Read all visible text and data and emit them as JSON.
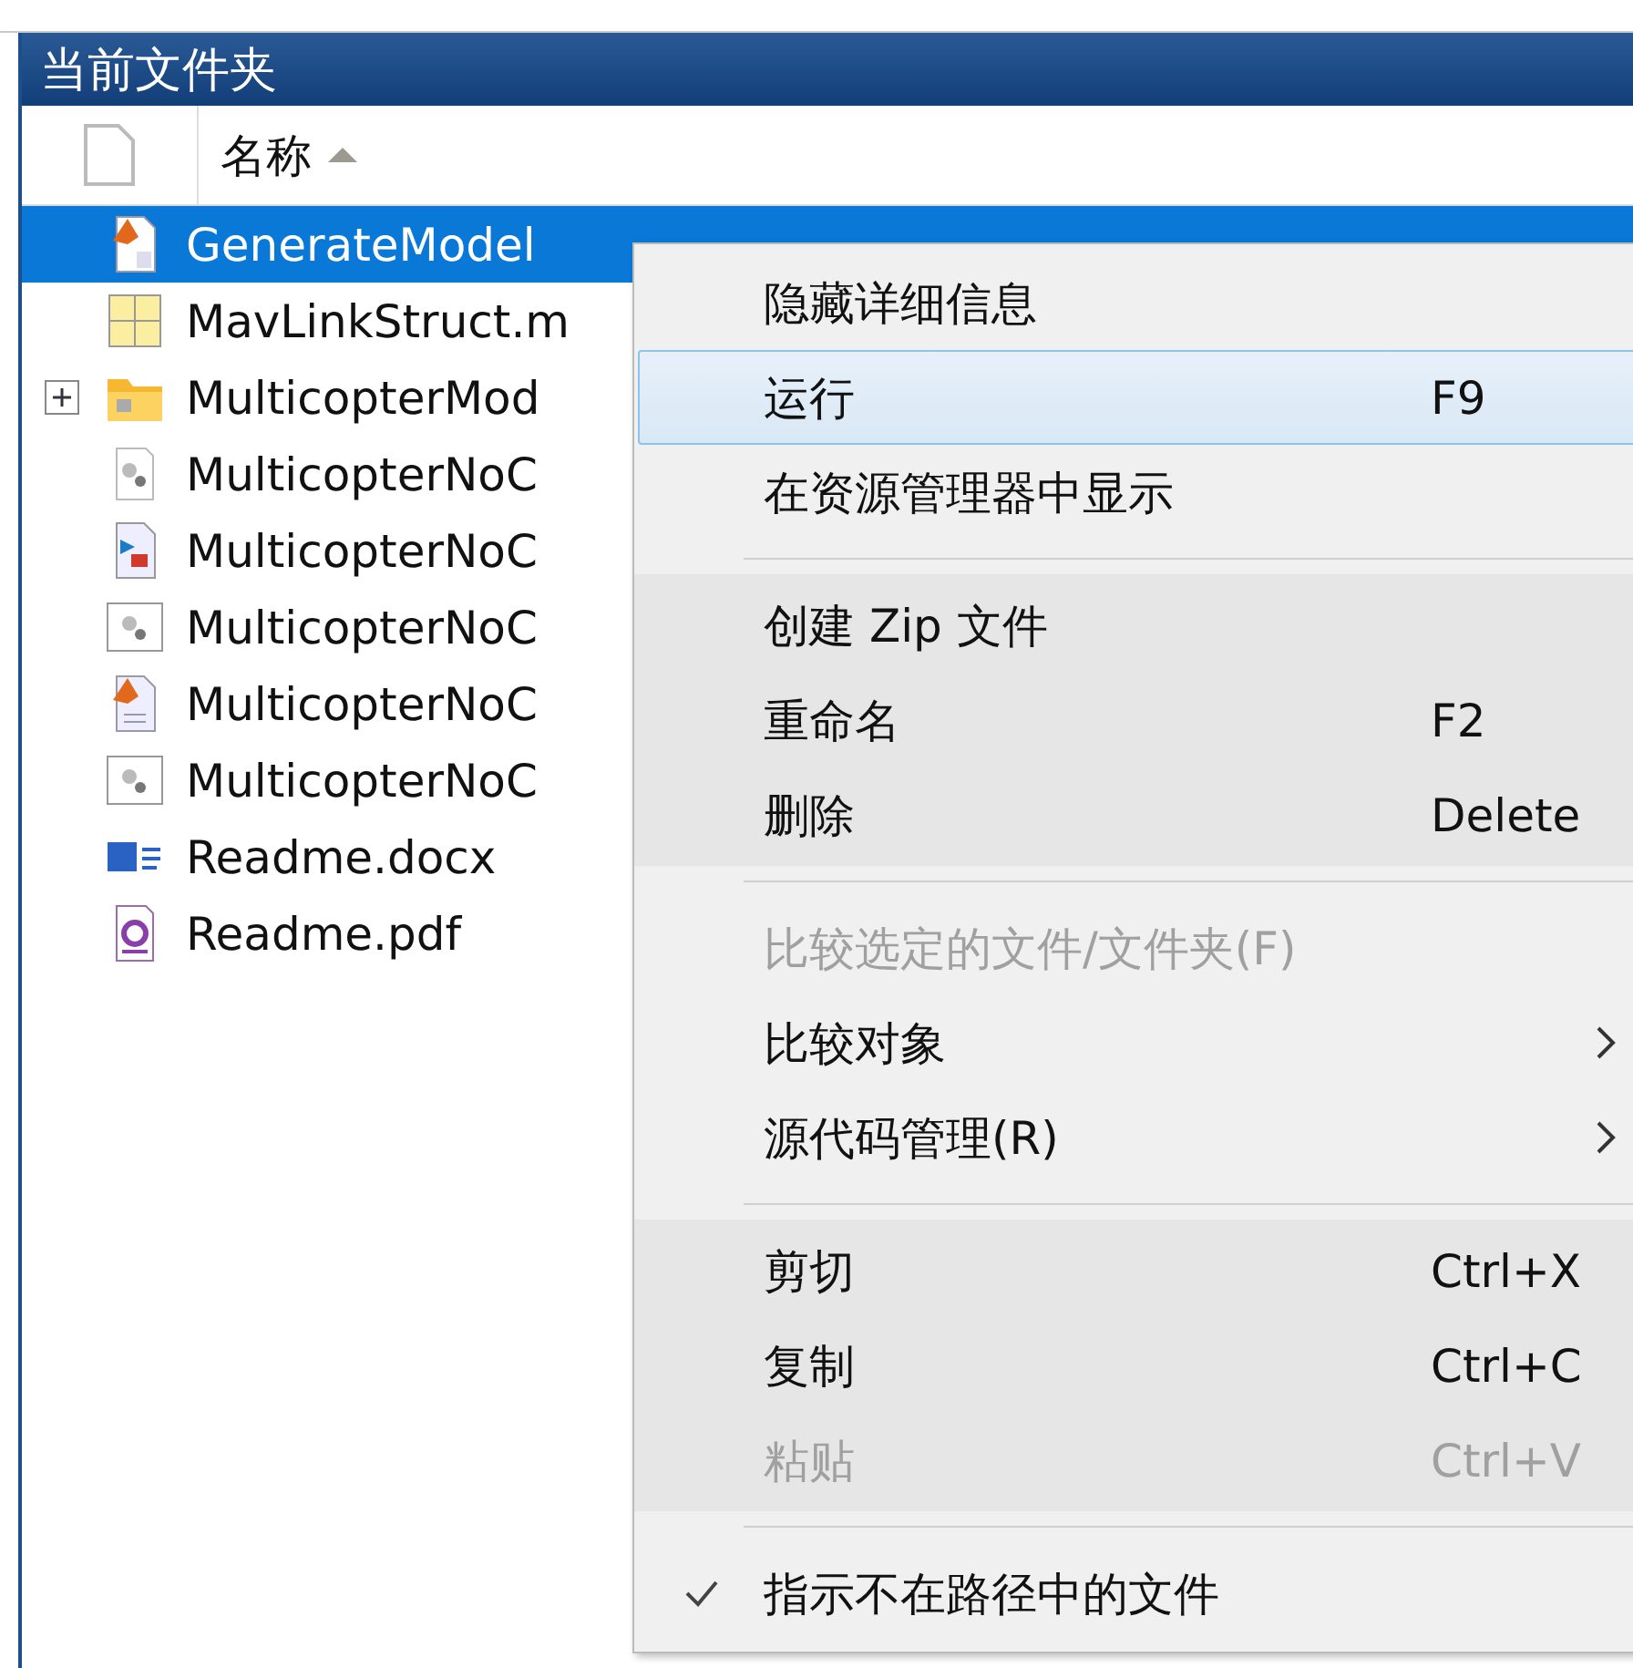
{
  "panel": {
    "title": "当前文件夹"
  },
  "table": {
    "columns": [
      {
        "label": "名称",
        "sorted": true
      }
    ],
    "rows": [
      {
        "name": "GenerateModel",
        "kind": "p-file",
        "selected": true,
        "expandable": false
      },
      {
        "name": "MavLinkStruct.m",
        "kind": "struct",
        "selected": false,
        "expandable": false
      },
      {
        "name": "MulticopterMod",
        "kind": "folder",
        "selected": false,
        "expandable": true
      },
      {
        "name": "MulticopterNoC",
        "kind": "gear-file",
        "selected": false,
        "expandable": false
      },
      {
        "name": "MulticopterNoC",
        "kind": "model",
        "selected": false,
        "expandable": false
      },
      {
        "name": "MulticopterNoC",
        "kind": "gear-box",
        "selected": false,
        "expandable": false
      },
      {
        "name": "MulticopterNoC",
        "kind": "script",
        "selected": false,
        "expandable": false
      },
      {
        "name": "MulticopterNoC",
        "kind": "gear-box",
        "selected": false,
        "expandable": false
      },
      {
        "name": "Readme.docx",
        "kind": "docx",
        "selected": false,
        "expandable": false
      },
      {
        "name": "Readme.pdf",
        "kind": "pdf",
        "selected": false,
        "expandable": false
      }
    ]
  },
  "context_menu": {
    "groups": [
      [
        {
          "label": "隐藏详细信息",
          "selected": false,
          "disabled": false
        },
        {
          "label": "运行",
          "shortcut": "F9",
          "selected": true,
          "disabled": false
        },
        {
          "label": "在资源管理器中显示",
          "selected": false,
          "disabled": false
        }
      ],
      [
        {
          "label": "创建 Zip 文件",
          "selected": false,
          "disabled": false
        },
        {
          "label": "重命名",
          "shortcut": "F2",
          "selected": false,
          "disabled": false
        },
        {
          "label": "删除",
          "shortcut": "Delete",
          "selected": false,
          "disabled": false
        }
      ],
      [
        {
          "label": "比较选定的文件/文件夹(F)",
          "selected": false,
          "disabled": true
        },
        {
          "label": "比较对象",
          "selected": false,
          "disabled": false,
          "submenu": true
        },
        {
          "label": "源代码管理(R)",
          "selected": false,
          "disabled": false,
          "submenu": true
        }
      ],
      [
        {
          "label": "剪切",
          "shortcut": "Ctrl+X",
          "selected": false,
          "disabled": false
        },
        {
          "label": "复制",
          "shortcut": "Ctrl+C",
          "selected": false,
          "disabled": false
        },
        {
          "label": "粘贴",
          "shortcut": "Ctrl+V",
          "selected": false,
          "disabled": true
        }
      ],
      [
        {
          "label": "指示不在路径中的文件",
          "selected": false,
          "disabled": false,
          "checked": true
        }
      ]
    ]
  }
}
